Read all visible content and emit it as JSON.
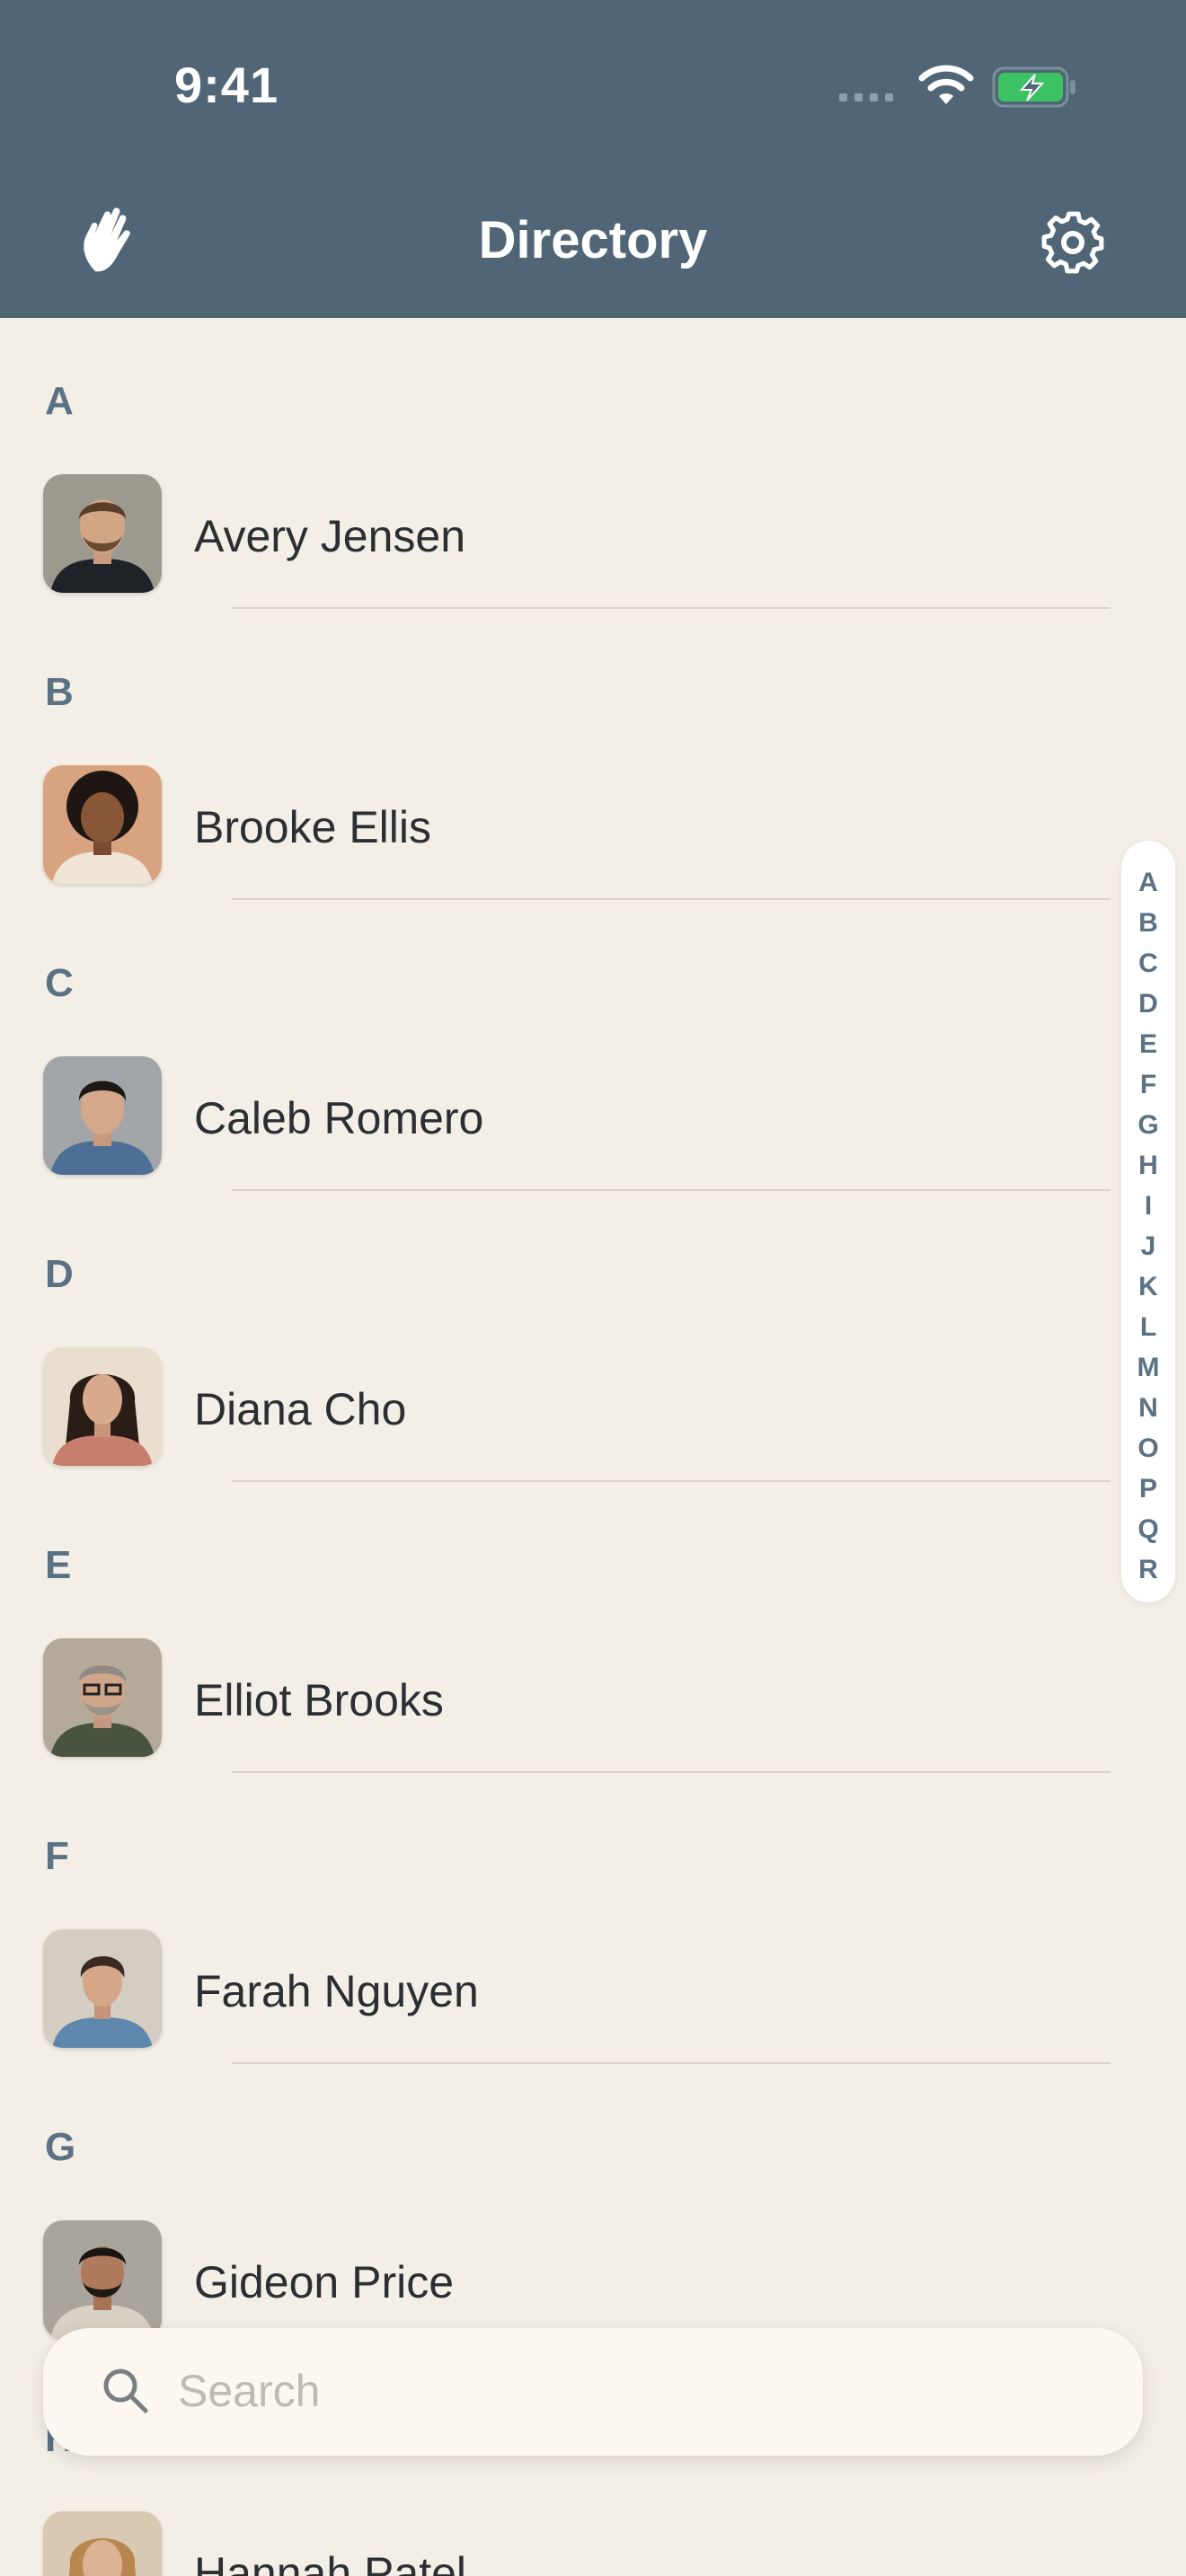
{
  "status_bar": {
    "time": "9:41"
  },
  "header": {
    "title": "Directory"
  },
  "icons": {
    "left": "waving-hand-icon",
    "right": "gear-icon",
    "search": "search-icon"
  },
  "colors": {
    "header_bg": "#506677",
    "background": "#f4efe6",
    "accent": "#5b7285",
    "battery": "#3cc163"
  },
  "contacts": [
    {
      "section": "A",
      "name": "Avery Jensen"
    },
    {
      "section": "B",
      "name": "Brooke Ellis"
    },
    {
      "section": "C",
      "name": "Caleb Romero"
    },
    {
      "section": "D",
      "name": "Diana Cho"
    },
    {
      "section": "E",
      "name": "Elliot Brooks"
    },
    {
      "section": "F",
      "name": "Farah Nguyen"
    },
    {
      "section": "G",
      "name": "Gideon Price"
    },
    {
      "section": "H",
      "name": "Hannah Patel"
    }
  ],
  "index_letters": [
    "A",
    "B",
    "C",
    "D",
    "E",
    "F",
    "G",
    "H",
    "I",
    "J",
    "K",
    "L",
    "M",
    "N",
    "O",
    "P",
    "Q",
    "R"
  ],
  "search": {
    "placeholder": "Search"
  }
}
